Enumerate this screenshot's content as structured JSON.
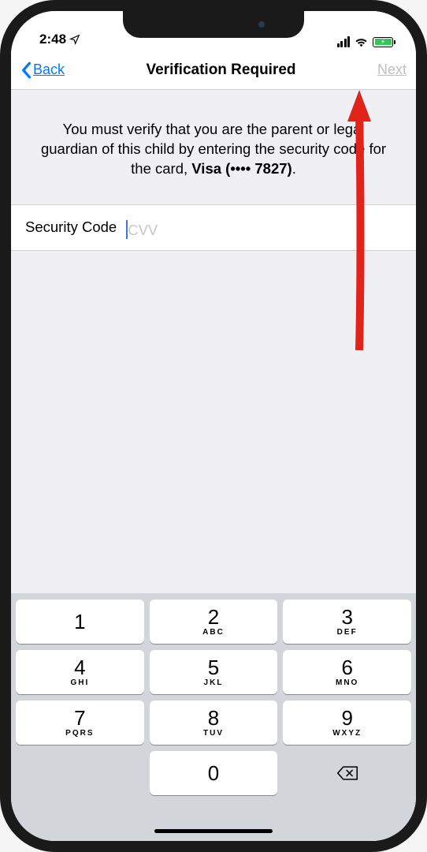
{
  "status": {
    "time": "2:48",
    "location_glyph": "➤"
  },
  "nav": {
    "back_label": "Back",
    "title": "Verification Required",
    "next_label": "Next"
  },
  "body": {
    "description_pre": "You must verify that you are the parent or legal guardian of this child by entering the security code for the card, ",
    "card_label": "Visa (•••• 7827)",
    "description_post": ".",
    "input_label": "Security Code",
    "input_placeholder": "CVV",
    "input_value": ""
  },
  "keypad": {
    "keys": [
      {
        "digit": "1",
        "letters": ""
      },
      {
        "digit": "2",
        "letters": "ABC"
      },
      {
        "digit": "3",
        "letters": "DEF"
      },
      {
        "digit": "4",
        "letters": "GHI"
      },
      {
        "digit": "5",
        "letters": "JKL"
      },
      {
        "digit": "6",
        "letters": "MNO"
      },
      {
        "digit": "7",
        "letters": "PQRS"
      },
      {
        "digit": "8",
        "letters": "TUV"
      },
      {
        "digit": "9",
        "letters": "WXYZ"
      },
      {
        "digit": "0",
        "letters": ""
      }
    ]
  },
  "annotation": {
    "arrow_color": "#e2231a"
  }
}
